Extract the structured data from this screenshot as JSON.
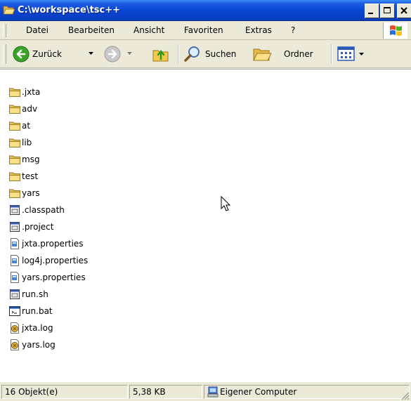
{
  "window": {
    "title": "C:\\workspace\\tsc++"
  },
  "menubar": {
    "items": [
      "Datei",
      "Bearbeiten",
      "Ansicht",
      "Favoriten",
      "Extras",
      "?"
    ]
  },
  "toolbar": {
    "back_label": "Zurück",
    "search_label": "Suchen",
    "folders_label": "Ordner"
  },
  "files": [
    {
      "name": ".jxta",
      "icon": "folder-icon"
    },
    {
      "name": "adv",
      "icon": "folder-icon"
    },
    {
      "name": "at",
      "icon": "folder-icon"
    },
    {
      "name": "lib",
      "icon": "folder-icon"
    },
    {
      "name": "msg",
      "icon": "folder-icon"
    },
    {
      "name": "test",
      "icon": "folder-icon"
    },
    {
      "name": "yars",
      "icon": "folder-icon"
    },
    {
      "name": ".classpath",
      "icon": "generic-file-icon"
    },
    {
      "name": ".project",
      "icon": "generic-file-icon"
    },
    {
      "name": "jxta.properties",
      "icon": "properties-file-icon"
    },
    {
      "name": "log4j.properties",
      "icon": "properties-file-icon"
    },
    {
      "name": "yars.properties",
      "icon": "properties-file-icon"
    },
    {
      "name": "run.sh",
      "icon": "generic-file-icon"
    },
    {
      "name": "run.bat",
      "icon": "batch-file-icon"
    },
    {
      "name": "jxta.log",
      "icon": "log-file-icon"
    },
    {
      "name": "yars.log",
      "icon": "log-file-icon"
    }
  ],
  "statusbar": {
    "count": "16 Objekt(e)",
    "size": "5,38 KB",
    "location": "Eigener Computer"
  },
  "colors": {
    "titlebar": "#0A46D4",
    "chrome": "#ECE9D8",
    "folder": "#F5D577"
  }
}
